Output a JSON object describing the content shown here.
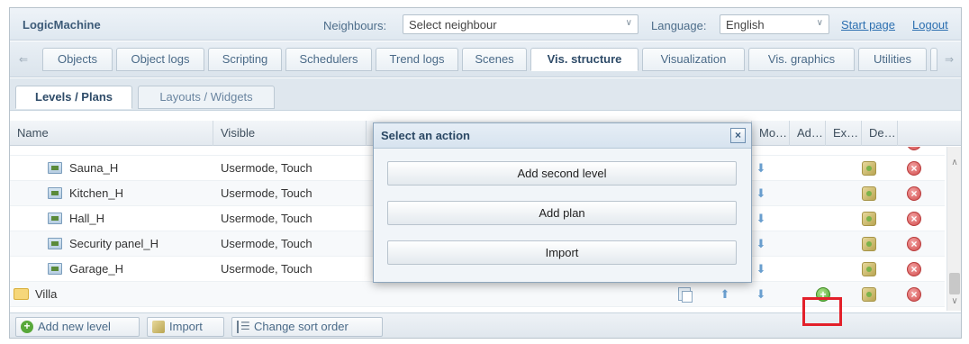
{
  "header": {
    "brand": "LogicMachine",
    "neighbours_label": "Neighbours:",
    "neighbours_value": "Select neighbour",
    "language_label": "Language:",
    "language_value": "English",
    "start_page": "Start page",
    "logout": "Logout"
  },
  "tabs": [
    {
      "label": "Objects"
    },
    {
      "label": "Object logs"
    },
    {
      "label": "Scripting"
    },
    {
      "label": "Schedulers"
    },
    {
      "label": "Trend logs"
    },
    {
      "label": "Scenes"
    },
    {
      "label": "Vis. structure",
      "active": true
    },
    {
      "label": "Visualization"
    },
    {
      "label": "Vis. graphics"
    },
    {
      "label": "Utilities"
    }
  ],
  "subtabs": [
    {
      "label": "Levels / Plans",
      "active": true
    },
    {
      "label": "Layouts / Widgets"
    }
  ],
  "columns": {
    "name": "Name",
    "visible": "Visible",
    "move": "Mo…",
    "add": "Ad…",
    "export": "Ex…",
    "delete": "De…"
  },
  "rows": [
    {
      "name": "Sauna_H",
      "visible": "Usermode, Touch",
      "type": "plan"
    },
    {
      "name": "Kitchen_H",
      "visible": "Usermode, Touch",
      "type": "plan"
    },
    {
      "name": "Hall_H",
      "visible": "Usermode, Touch",
      "type": "plan"
    },
    {
      "name": "Security panel_H",
      "visible": "Usermode, Touch",
      "type": "plan"
    },
    {
      "name": "Garage_H",
      "visible": "Usermode, Touch",
      "type": "plan"
    },
    {
      "name": "Villa",
      "visible": "",
      "type": "level"
    }
  ],
  "bottom": {
    "add_new_level": "Add new level",
    "import": "Import",
    "change_sort_order": "Change sort order"
  },
  "modal": {
    "title": "Select an action",
    "close": "×",
    "actions": [
      "Add second level",
      "Add plan",
      "Import"
    ]
  },
  "colors": {
    "highlight": "#e3202a",
    "accent": "#2f4c69"
  }
}
